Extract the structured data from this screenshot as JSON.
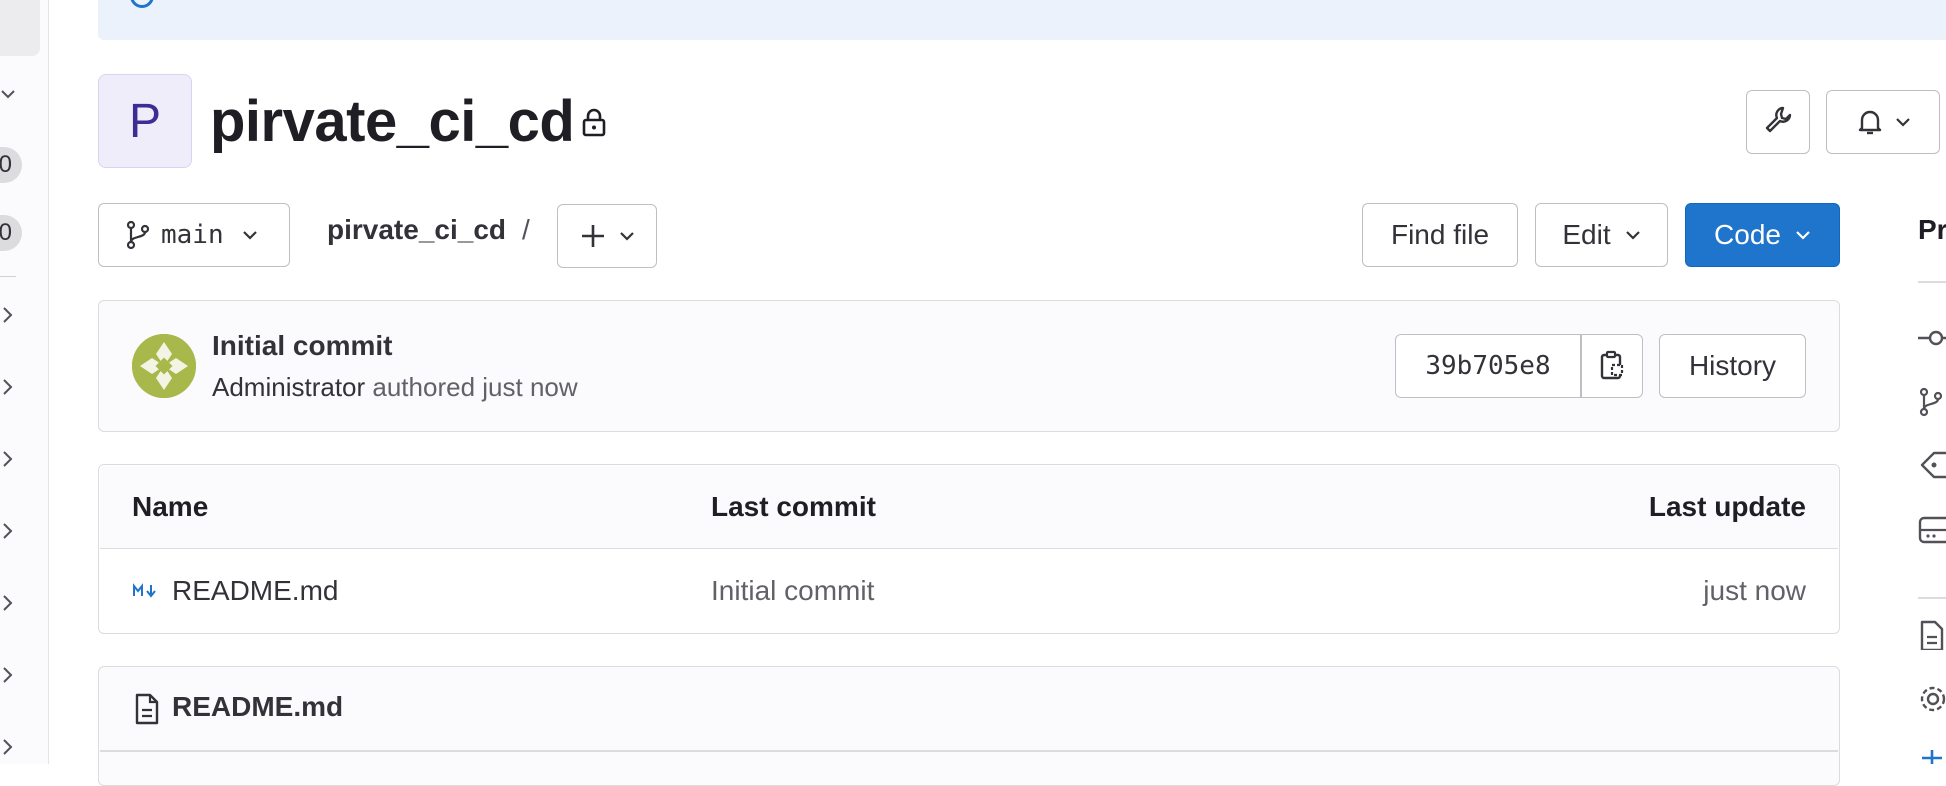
{
  "project": {
    "avatar_letter": "P",
    "name": "pirvate_ci_cd"
  },
  "repo_nav": {
    "branch": "main",
    "breadcrumb_project": "pirvate_ci_cd",
    "breadcrumb_separator": "/",
    "find_file_label": "Find file",
    "edit_label": "Edit",
    "code_label": "Code"
  },
  "sidebar": {
    "counts": [
      "0",
      "0"
    ]
  },
  "last_commit": {
    "title": "Initial commit",
    "author": "Administrator",
    "meta": "authored just now",
    "sha": "39b705e8",
    "history_label": "History"
  },
  "file_table": {
    "columns": [
      "Name",
      "Last commit",
      "Last update"
    ],
    "rows": [
      {
        "name": "README.md",
        "last_commit": "Initial commit",
        "last_update": "just now"
      }
    ]
  },
  "readme": {
    "title": "README.md"
  },
  "right_sidebar": {
    "heading": "Pr"
  },
  "colors": {
    "primary": "#1f75cb",
    "avatar_bg": "#f0edfb",
    "avatar_text": "#3c2c93",
    "banner_bg": "#ecf2fb"
  }
}
